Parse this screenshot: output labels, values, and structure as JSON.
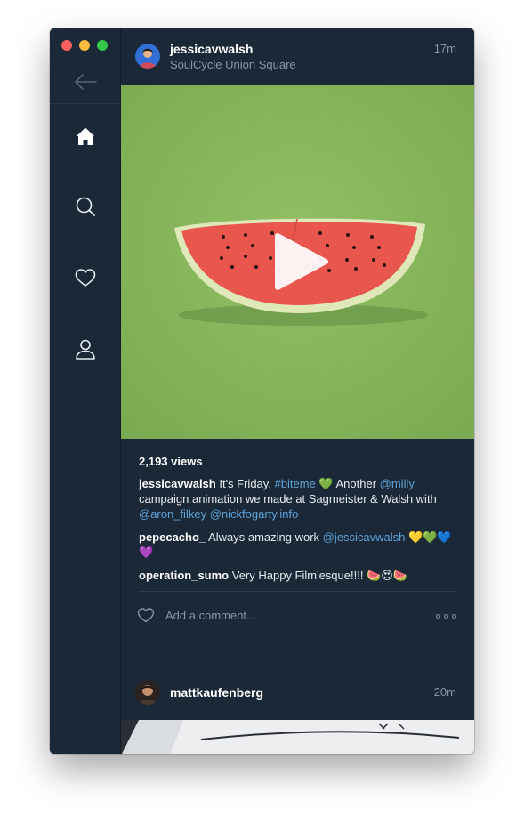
{
  "sidebar": {
    "back_icon": "arrow-left-icon",
    "items": [
      {
        "icon": "home-icon",
        "active": true
      },
      {
        "icon": "search-icon",
        "active": false
      },
      {
        "icon": "heart-icon",
        "active": false
      },
      {
        "icon": "profile-icon",
        "active": false
      }
    ]
  },
  "post": {
    "username": "jessicavwalsh",
    "location": "SoulCycle Union Square",
    "time": "17m",
    "media_icon": "play-icon",
    "views": "2,193 views",
    "caption": {
      "user": "jessicavwalsh",
      "p1": " It's Friday, ",
      "tag": "#biteme",
      "emoji1": " 💚 ",
      "p2": "Another ",
      "mention1": "@milly",
      "p3": " campaign animation we made at Sagmeister & Walsh with ",
      "mention2": "@aron_filkey",
      "sp": " ",
      "mention3": "@nickfogarty.info"
    },
    "comments": [
      {
        "user": "pepecacho_",
        "pre": " Always amazing work ",
        "mention": "@jessicavwalsh",
        "post": " 💛💚💙💜"
      },
      {
        "user": "operation_sumo",
        "text": " Very Happy Film'esque!!!! 🍉😍🍉"
      }
    ],
    "comment_placeholder": "Add a comment..."
  },
  "next_post": {
    "username": "mattkaufenberg",
    "time": "20m"
  },
  "colors": {
    "background": "#1b2838",
    "link": "#5fa2d8",
    "muted": "#8797a8",
    "media_green": "#8bb85e"
  }
}
